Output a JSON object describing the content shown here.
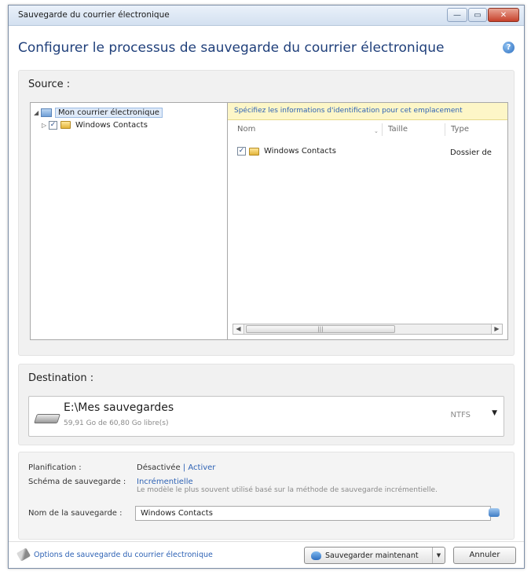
{
  "window": {
    "title": "Sauvegarde du courrier électronique",
    "minimize_glyph": "—",
    "maximize_glyph": "▭",
    "close_glyph": "✕"
  },
  "heading": "Configurer le processus de sauvegarde du courrier électronique",
  "help_glyph": "?",
  "source": {
    "label": "Source :",
    "tree": {
      "root": {
        "expander": "◢",
        "label": "Mon courrier électronique"
      },
      "child": {
        "expander": "▷",
        "checked": true,
        "check_glyph": "✓",
        "label": "Windows Contacts"
      }
    },
    "list": {
      "info_bar": "Spécifiez les informations d'identification pour cet emplacement",
      "columns": [
        "Nom",
        "Taille",
        "Type"
      ],
      "sort_glyph": "⌄",
      "rows": [
        {
          "checked": true,
          "check_glyph": "✓",
          "name": "Windows Contacts",
          "size": "",
          "type": "Dossier de"
        }
      ],
      "scroll_left_glyph": "◀",
      "scroll_right_glyph": "▶",
      "scroll_thumb_glyph": "|||"
    }
  },
  "destination": {
    "label": "Destination :",
    "path": "E:\\Mes sauvegardes",
    "free_space": "59,91 Go de 60,80 Go libre(s)",
    "filesystem": "NTFS",
    "dropdown_glyph": "▼"
  },
  "options": {
    "schedule": {
      "label": "Planification :",
      "status": "Désactivée",
      "separator": "|",
      "action": "Activer"
    },
    "scheme": {
      "label": "Schéma de sauvegarde :",
      "value": "Incrémentielle",
      "description": "Le modèle le plus souvent utilisé basé sur la méthode de sauvegarde incrémentielle."
    },
    "name": {
      "label": "Nom de la sauvegarde :",
      "value": "Windows Contacts"
    }
  },
  "footer": {
    "options_link": "Options de sauvegarde du courrier électronique",
    "backup_now": "Sauvegarder maintenant",
    "split_glyph": "▼",
    "cancel": "Annuler"
  },
  "colors": {
    "link": "#2f63b5",
    "heading": "#1f3f7a",
    "info_bar_bg": "#fdf6c7",
    "close_button": "#c7412a"
  },
  "icons": [
    "mail-icon",
    "checkbox-icon",
    "folder-icon",
    "drive-icon",
    "help-icon",
    "chat-icon",
    "wrench-icon",
    "backup-icon"
  ]
}
